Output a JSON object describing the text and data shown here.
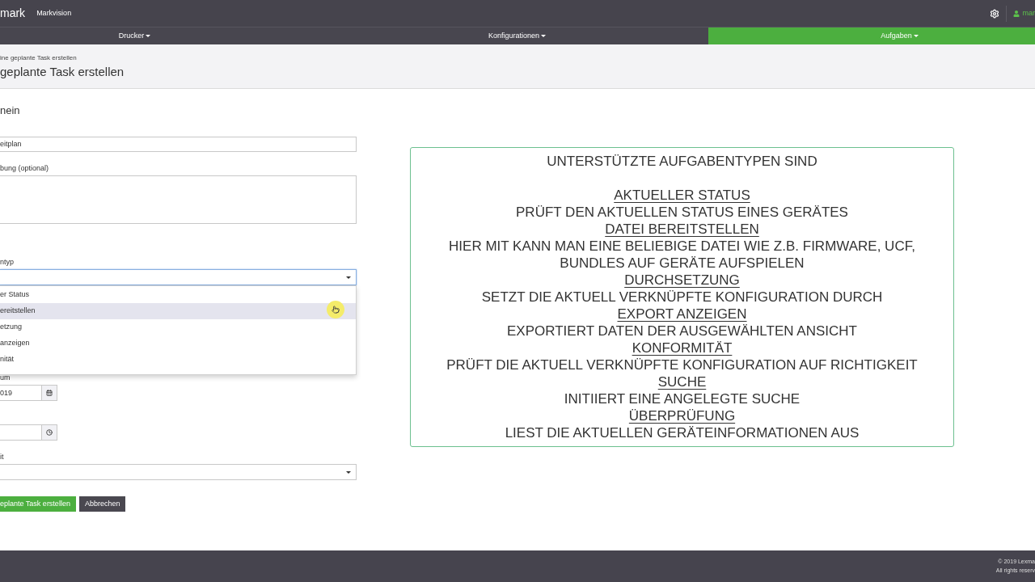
{
  "header": {
    "logo": "mark",
    "app_name": "Markvision",
    "user": "mar"
  },
  "nav": [
    {
      "label": "Drucker",
      "selected": false
    },
    {
      "label": "Konfigurationen",
      "selected": false
    },
    {
      "label": "Aufgaben",
      "selected": true
    }
  ],
  "page_header": {
    "breadcrumb": "ine geplante Task erstellen",
    "title": "geplante Task erstellen"
  },
  "form": {
    "section_title": "nein",
    "fields": [
      {
        "kind": "text",
        "value": "eitplan"
      },
      {
        "kind": "textarea",
        "label": "bung (optional)"
      },
      {
        "kind": "select",
        "label": "ntyp",
        "focused": true,
        "expanded": true,
        "options": [
          {
            "label": "er Status",
            "selected": false
          },
          {
            "label": "ereitstellen",
            "selected": true
          },
          {
            "label": "etzung",
            "selected": false
          },
          {
            "label": "anzeigen",
            "selected": false
          },
          {
            "label": "nität",
            "selected": false
          }
        ]
      },
      {
        "kind": "date",
        "label": "um",
        "value": "019"
      },
      {
        "kind": "time"
      },
      {
        "kind": "select",
        "label": "it",
        "focused": false
      }
    ],
    "buttons": [
      {
        "label": "eplante Task erstellen",
        "kind": "primary"
      },
      {
        "label": "Abbrechen",
        "kind": "secondary"
      }
    ]
  },
  "info_panel": {
    "title": "UNTERSTÜTZTE AUFGABENTYPEN SIND",
    "task_types": [
      {
        "name": "AKTUELLER STATUS",
        "description": "PRÜFT DEN AKTUELLEN STATUS EINES GERÄTES"
      },
      {
        "name": "DATEI BEREITSTELLEN",
        "description": "HIER MIT KANN MAN EINE BELIEBIGE DATEI WIE Z.B. FIRMWARE, UCF, BUNDLES AUF GERÄTE AUFSPIELEN"
      },
      {
        "name": "DURCHSETZUNG",
        "description": "SETZT DIE AKTUELL VERKNÜPFTE KONFIGURATION DURCH"
      },
      {
        "name": "EXPORT ANZEIGEN",
        "description": "EXPORTIERT DATEN DER AUSGEWÄHLTEN ANSICHT"
      },
      {
        "name": "KONFORMITÄT",
        "description": "PRÜFT DIE AKTUELL VERKNÜPFTE KONFIGURATION AUF RICHTIGKEIT"
      },
      {
        "name": "SUCHE",
        "description": "INITIIERT EINE ANGELEGTE SUCHE"
      },
      {
        "name": "ÜBERPRÜFUNG",
        "description": "LIEST DIE AKTUELLEN GERÄTEINFORMATIONEN AUS"
      }
    ]
  },
  "footer": {
    "copyright": "© 2019 Lexma",
    "rights": "All rights reserv"
  }
}
